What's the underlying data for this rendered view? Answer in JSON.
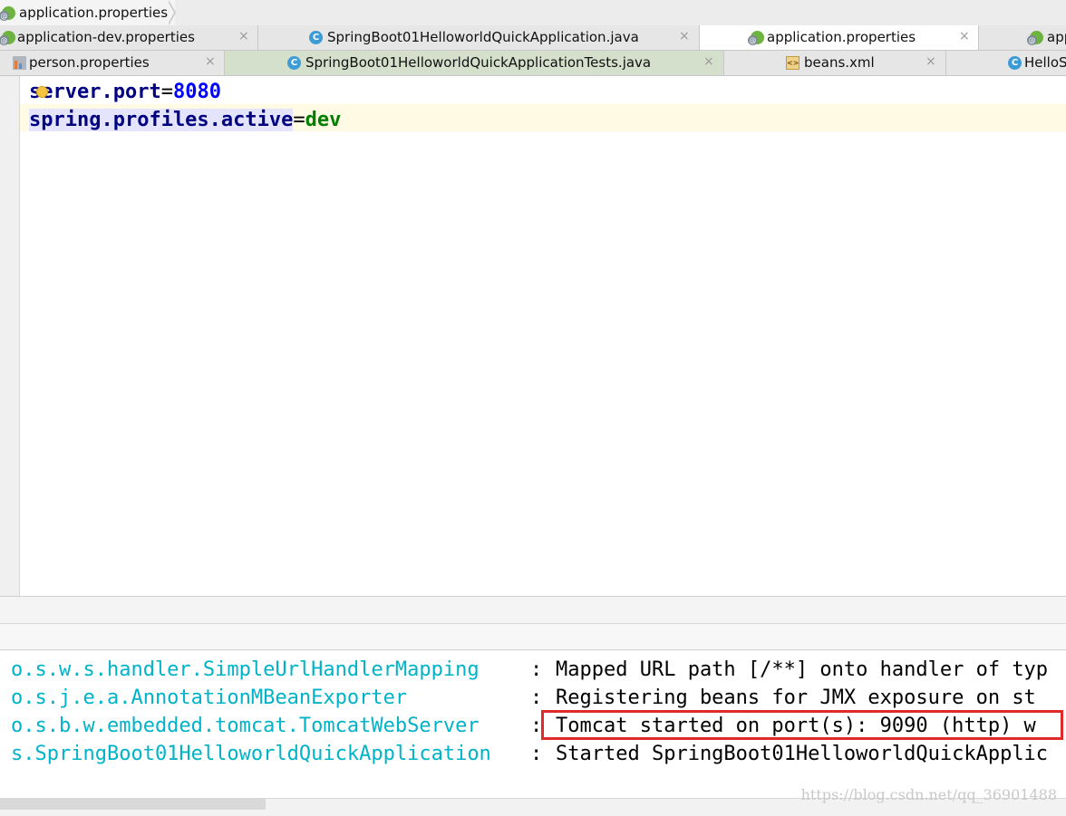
{
  "breadcrumb": {
    "file": "application.properties"
  },
  "tabs_row1": [
    {
      "label": "application-dev.properties",
      "icon": "spring-config-icon"
    },
    {
      "label": "SpringBoot01HelloworldQuickApplication.java",
      "icon": "class-icon"
    },
    {
      "label": "application.properties",
      "icon": "spring-config-icon",
      "active": true
    },
    {
      "label": "app",
      "icon": "spring-config-icon"
    }
  ],
  "tabs_row2": [
    {
      "label": "person.properties",
      "icon": "properties-icon"
    },
    {
      "label": "SpringBoot01HelloworldQuickApplicationTests.java",
      "icon": "class-icon"
    },
    {
      "label": "beans.xml",
      "icon": "xml-icon"
    },
    {
      "label": "HelloS",
      "icon": "class-icon"
    }
  ],
  "tab_close_glyph": "×",
  "class_icon_letter": "C",
  "xml_icon_glyph": "<>",
  "editor": {
    "lines": [
      {
        "key": "server.port",
        "eq": "=",
        "value": "8080"
      },
      {
        "key": "spring.profiles.active",
        "eq": "=",
        "value": "dev"
      }
    ]
  },
  "console": {
    "colon": ":",
    "lines": [
      {
        "logger": "o.s.w.s.handler.SimpleUrlHandlerMapping",
        "message": "Mapped URL path [/**] onto handler of typ"
      },
      {
        "logger": "o.s.j.e.a.AnnotationMBeanExporter",
        "message": "Registering beans for JMX exposure on st"
      },
      {
        "logger": "o.s.b.w.embedded.tomcat.TomcatWebServer",
        "message": "Tomcat started on port(s): 9090 (http) w"
      },
      {
        "logger": "s.SpringBoot01HelloworldQuickApplication",
        "message": "Started SpringBoot01HelloworldQuickApplic"
      }
    ]
  },
  "watermark": "https://blog.csdn.net/qq_36901488",
  "colors": {
    "logger": "#00b3c8",
    "highlight_box": "#e02a2a",
    "key": "#000080",
    "number": "#0000ff",
    "string_value": "#008000"
  }
}
